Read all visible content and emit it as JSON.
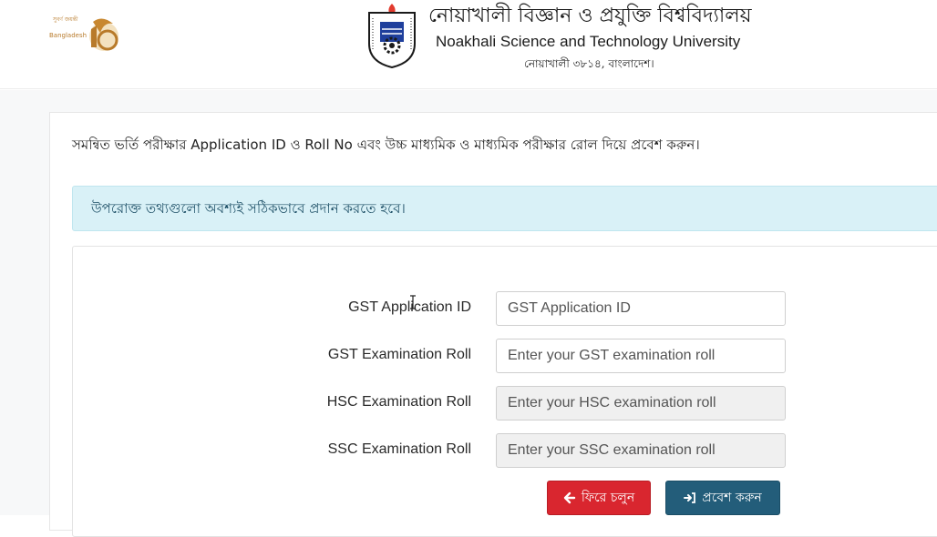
{
  "header": {
    "jubilee_logo": {
      "text_top": "সুবর্ণ জয়ন্তী",
      "text_country": "Bangladesh",
      "number": "50"
    },
    "title_bn": "নোয়াখালী বিজ্ঞান ও প্রযুক্তি বিশ্ববিদ্যালয়",
    "title_en": "Noakhali Science and Technology University",
    "address_bn": "নোয়াখালী ৩৮১৪, বাংলাদেশ।"
  },
  "instruction": "সমন্বিত ভর্তি পরীক্ষার Application ID ও Roll No এবং উচ্চ মাধ্যমিক ও মাধ্যমিক পরীক্ষার রোল দিয়ে প্রবেশ করুন।",
  "alert": "উপরোক্ত তথ্যগুলো অবশ্যই সঠিকভাবে প্রদান করতে হবে।",
  "form": {
    "fields": [
      {
        "label": "GST Application ID",
        "placeholder": "GST Application ID"
      },
      {
        "label": "GST Examination Roll",
        "placeholder": "Enter your GST examination roll"
      },
      {
        "label": "HSC Examination Roll",
        "placeholder": "Enter your HSC examination roll"
      },
      {
        "label": "SSC Examination Roll",
        "placeholder": "Enter your SSC examination roll"
      }
    ],
    "back_label": "ফিরে চলুন",
    "enter_label": "প্রবেশ করুন"
  },
  "colors": {
    "back_button": "#d9262f",
    "enter_button": "#235d7a",
    "alert_bg": "#d9f1f7",
    "alert_text": "#1d4f66"
  },
  "icons": {
    "back": "arrow-left-icon",
    "enter": "sign-in-icon"
  }
}
